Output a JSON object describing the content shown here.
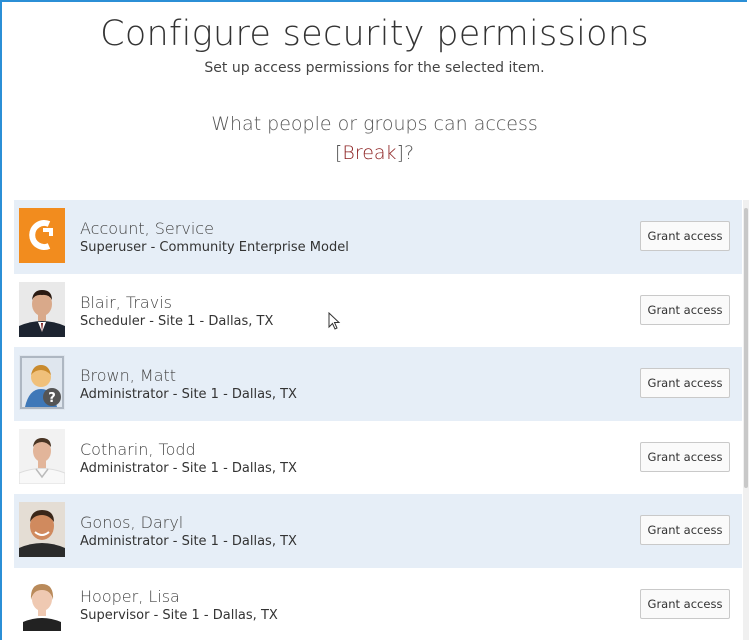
{
  "dialog": {
    "title": "Configure security permissions",
    "subtitle": "Set up access permissions for the selected item.",
    "question_line1": "What people or groups can access",
    "bracket_open": "[",
    "item_name": "Break",
    "bracket_close": "]?"
  },
  "users": [
    {
      "name": "Account, Service",
      "role": "Superuser - Community Enterprise Model",
      "avatar": "service-logo-icon",
      "button": "Grant access"
    },
    {
      "name": "Blair, Travis",
      "role": "Scheduler - Site 1 - Dallas, TX",
      "avatar": "user-photo",
      "button": "Grant access"
    },
    {
      "name": "Brown, Matt",
      "role": "Administrator - Site 1 - Dallas, TX",
      "avatar": "unknown-user-icon",
      "button": "Grant access"
    },
    {
      "name": "Cotharin, Todd",
      "role": "Administrator - Site 1 - Dallas, TX",
      "avatar": "user-photo",
      "button": "Grant access"
    },
    {
      "name": "Gonos, Daryl",
      "role": "Administrator - Site 1 - Dallas, TX",
      "avatar": "user-photo",
      "button": "Grant access"
    },
    {
      "name": "Hooper, Lisa",
      "role": "Supervisor - Site 1 - Dallas, TX",
      "avatar": "user-photo",
      "button": "Grant access"
    }
  ],
  "colors": {
    "frame_border": "#2b8fd6",
    "row_alt_bg": "#e6eef7",
    "item_name": "#8b1e1e",
    "service_logo": "#f28c1e"
  }
}
